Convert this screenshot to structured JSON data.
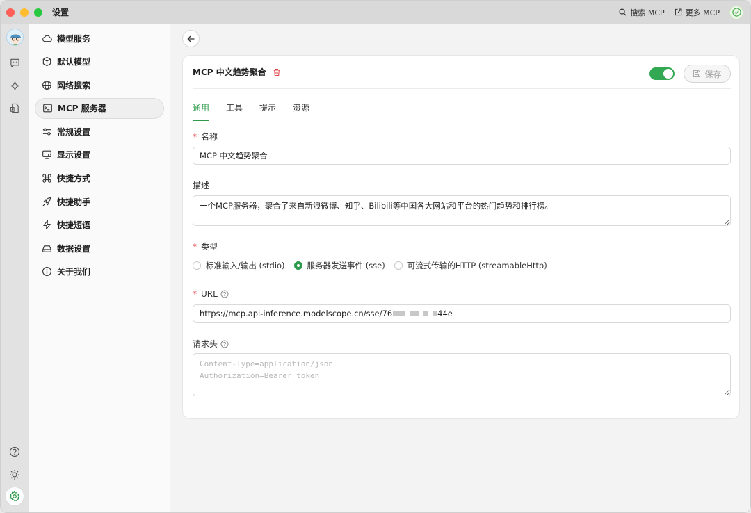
{
  "window": {
    "title": "设置"
  },
  "topbar": {
    "search_mcp_label": "搜索 MCP",
    "more_mcp_label": "更多 MCP"
  },
  "sidebar": {
    "items": [
      {
        "label": "模型服务",
        "icon": "cloud-icon"
      },
      {
        "label": "默认模型",
        "icon": "cube-icon"
      },
      {
        "label": "网络搜索",
        "icon": "globe-icon"
      },
      {
        "label": "MCP 服务器",
        "icon": "terminal-icon",
        "active": true
      },
      {
        "label": "常规设置",
        "icon": "sliders-icon"
      },
      {
        "label": "显示设置",
        "icon": "monitor-icon"
      },
      {
        "label": "快捷方式",
        "icon": "command-icon"
      },
      {
        "label": "快捷助手",
        "icon": "rocket-icon"
      },
      {
        "label": "快捷短语",
        "icon": "zap-icon"
      },
      {
        "label": "数据设置",
        "icon": "drive-icon"
      },
      {
        "label": "关于我们",
        "icon": "info-icon"
      }
    ]
  },
  "server": {
    "title": "MCP 中文趋势聚合",
    "enabled": true,
    "save_label": "保存",
    "tabs": [
      "通用",
      "工具",
      "提示",
      "资源"
    ],
    "active_tab": "通用",
    "name_label": "名称",
    "name_value": "MCP 中文趋势聚合",
    "desc_label": "描述",
    "desc_value": "一个MCP服务器，聚合了来自新浪微博、知乎、Bilibili等中国各大网站和平台的热门趋势和排行榜。",
    "type_label": "类型",
    "type_options": [
      "标准输入/输出 (stdio)",
      "服务器发送事件 (sse)",
      "可流式传输的HTTP (streamableHttp)"
    ],
    "type_selected": "服务器发送事件 (sse)",
    "url_label": "URL",
    "url_prefix": "https://mcp.api-inference.modelscope.cn/sse/76",
    "url_suffix": "44e",
    "headers_label": "请求头",
    "headers_placeholder": "Content-Type=application/json\nAuthorization=Bearer token"
  },
  "colors": {
    "accent": "#2c9a4a",
    "danger": "#e5484d"
  }
}
